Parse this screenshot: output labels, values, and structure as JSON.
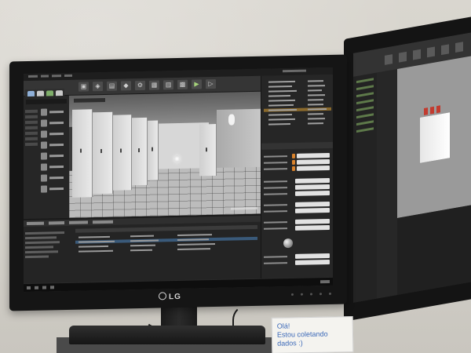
{
  "monitor_main": {
    "brand": "LG"
  },
  "sticky_note": {
    "line1": "Olá!",
    "line2": "Estou coletando dados :)"
  },
  "colors": {
    "wall": "#d6d3cc",
    "bezel": "#151515",
    "editor_panel": "#262626",
    "selection": "#8b6a2c",
    "accent_orange": "#d9822b"
  }
}
